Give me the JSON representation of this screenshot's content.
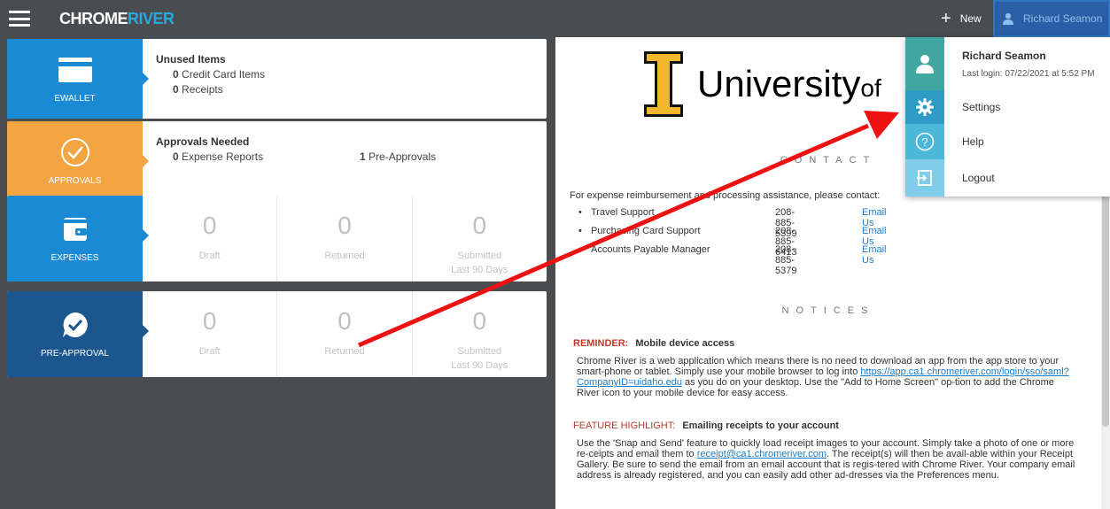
{
  "topbar": {
    "logo_part1": "CHROME",
    "logo_part2": "RIVER",
    "new_label": "New",
    "user_label": "Richard Seamon"
  },
  "tiles": {
    "ewallet": {
      "label": "EWALLET",
      "title": "Unused Items",
      "credit_count": "0",
      "credit_label": "Credit Card Items",
      "receipt_count": "0",
      "receipt_label": "Receipts"
    },
    "approvals": {
      "label": "APPROVALS",
      "title": "Approvals Needed",
      "expense_count": "0",
      "expense_label": "Expense Reports",
      "preapp_count": "1",
      "preapp_label": "Pre-Approvals"
    },
    "expenses": {
      "label": "EXPENSES",
      "cells": [
        {
          "num": "0",
          "cap": "Draft"
        },
        {
          "num": "0",
          "cap": "Returned"
        },
        {
          "num": "0",
          "cap": "Submitted",
          "cap2": "Last 90 Days"
        }
      ]
    },
    "preapproval": {
      "label": "PRE-APPROVAL",
      "cells": [
        {
          "num": "0",
          "cap": "Draft"
        },
        {
          "num": "0",
          "cap": "Returned"
        },
        {
          "num": "0",
          "cap": "Submitted",
          "cap2": "Last 90 Days"
        }
      ]
    }
  },
  "right": {
    "uni_text": "University",
    "uni_suffix": "of",
    "contact_heading": "CONTACT",
    "contact_intro": "For expense reimbursement and processing assistance, please contact:",
    "contacts": [
      {
        "name": "Travel Support",
        "phone": "208-885-5399",
        "email": "Email Us"
      },
      {
        "name": "Purchasing Card Support",
        "phone": "208-885-6413",
        "email": "Email Us"
      },
      {
        "name": "Accounts Payable Manager",
        "phone": "208-885-5379",
        "email": "Email Us"
      }
    ],
    "notices_heading": "NOTICES",
    "notice1": {
      "tag": "REMINDER:",
      "title": "Mobile device access",
      "body1": "Chrome River is a web application which means there is no need to download an app from the app store to your smart-phone or tablet. Simply use your mobile browser to log into ",
      "link": "https://app.ca1.chromeriver.com/login/sso/saml?CompanyID=uidaho.edu",
      "body2": " as you do on your desktop. Use the \"Add to Home Screen\" op-tion to add the Chrome River icon to your mobile device for easy access."
    },
    "notice2": {
      "tag": "FEATURE HIGHLIGHT:",
      "title": "Emailing receipts to your account",
      "body1": "Use the 'Snap and Send' feature to quickly load receipt images to your account. Simply take a photo of one or more re-ceipts and email them to ",
      "link": "receipt@ca1.chromeriver.com",
      "body2": ". The receipt(s) will then be avail-able within your Receipt Gallery. Be sure to send the email from an email account that is regis-tered with Chrome River. Your company email address is already registered, and you can easily add other ad-dresses via the Preferences menu."
    }
  },
  "menu": {
    "name": "Richard Seamon",
    "last_login": "Last login: 07/22/2021 at 5:52 PM",
    "settings": "Settings",
    "help": "Help",
    "logout": "Logout"
  },
  "colors": {
    "topbar": "#4a4d50",
    "blue": "#1a8ad4",
    "orange": "#f2a541",
    "navy": "#1b568f",
    "arrow": "#ee1111"
  }
}
